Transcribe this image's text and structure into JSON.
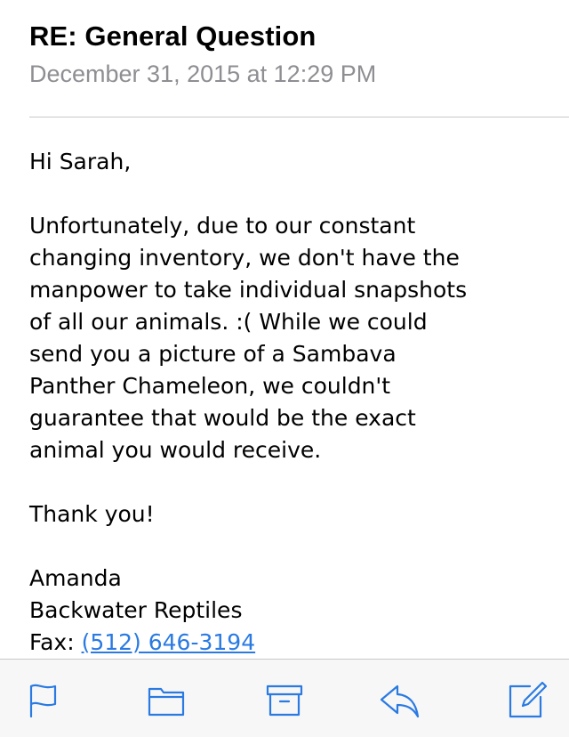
{
  "email": {
    "subject": "RE: General Question",
    "date": "December 31, 2015 at 12:29 PM",
    "body": {
      "greeting": "Hi Sarah,",
      "paragraph_lines": [
        "Unfortunately, due to our constant",
        "changing inventory, we don't have the",
        "manpower to take individual snapshots",
        "of all our animals. :( While we could",
        "send you a picture of a Sambava",
        "Panther Chameleon, we couldn't",
        "guarantee that would be the exact",
        "animal you would receive."
      ],
      "closing": "Thank you!",
      "signature": {
        "name": "Amanda",
        "company": "Backwater Reptiles",
        "fax_label": "Fax: ",
        "fax_number": "(512) 646-3194"
      }
    }
  },
  "toolbar": {
    "accent_color": "#2a7ae2",
    "buttons": [
      {
        "icon": "flag-icon",
        "action": "flag"
      },
      {
        "icon": "folder-icon",
        "action": "move"
      },
      {
        "icon": "archive-icon",
        "action": "archive"
      },
      {
        "icon": "reply-icon",
        "action": "reply"
      },
      {
        "icon": "compose-icon",
        "action": "compose"
      }
    ]
  }
}
